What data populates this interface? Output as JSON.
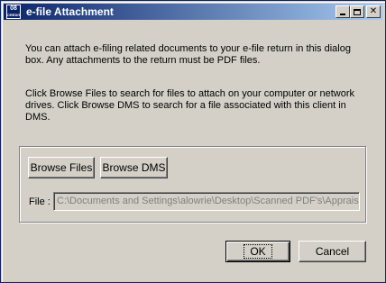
{
  "window": {
    "title": "e-file Attachment",
    "icon_text_top": "08",
    "icon_text_bottom": "CREDIT",
    "controls": {
      "minimize": "minimize-icon",
      "maximize": "maximize-icon",
      "close": "✕"
    }
  },
  "main": {
    "paragraph1": "You can attach e-filing related documents to your e-file return in this dialog box. Any attachments to the return must be PDF files.",
    "paragraph2": "Click Browse Files to search for files to attach on your computer or network drives. Click Browse DMS to search for a file associated with this client in DMS."
  },
  "group": {
    "browse_files_label": "Browse Files",
    "browse_dms_label": "Browse DMS",
    "file_label": "File :",
    "file_value": "C:\\Documents and Settings\\alowrie\\Desktop\\Scanned PDF's\\Apprais"
  },
  "footer": {
    "ok_label": "OK",
    "cancel_label": "Cancel"
  }
}
